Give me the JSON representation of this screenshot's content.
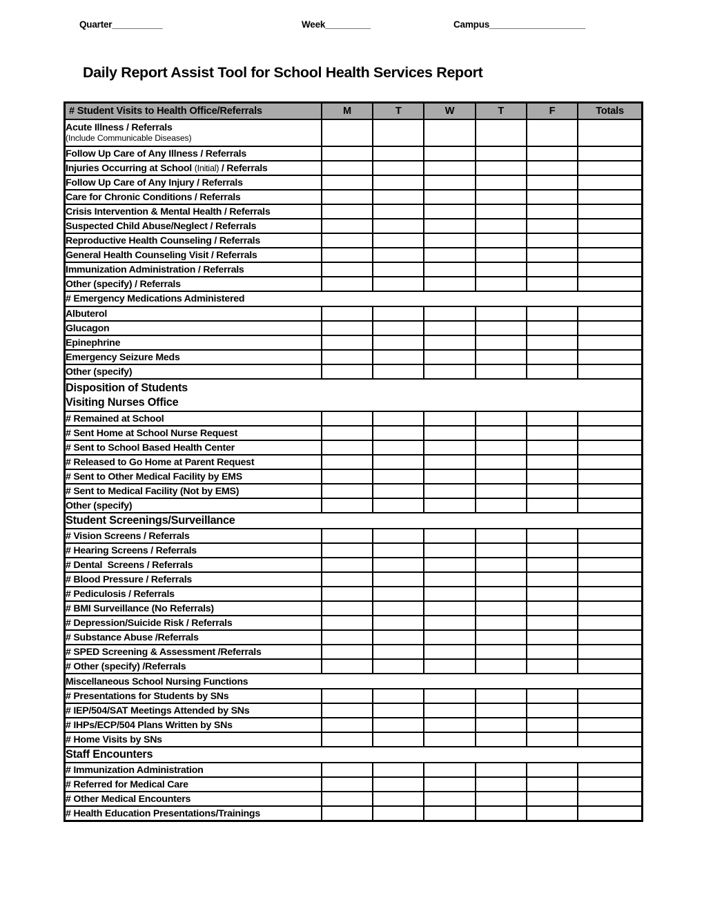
{
  "header": {
    "quarter": "Quarter__________",
    "week": "Week_________",
    "campus": "Campus___________________"
  },
  "title": "Daily Report Assist Tool for School Health Services Report",
  "table": {
    "columns": {
      "label": "# Student Visits to Health Office/Referrals",
      "days": [
        "M",
        "T",
        "W",
        "T",
        "F"
      ],
      "totals": "Totals"
    },
    "sections": [
      {
        "id": "student-visits",
        "header_in_column_row": true,
        "rows": [
          {
            "label": "Acute Illness / Referrals",
            "sub": "(Include Communicable Diseases)",
            "tall": true
          },
          {
            "label": "Follow Up Care of Any Illness / Referrals"
          },
          {
            "label_pre": "Injuries Occurring at School ",
            "label_reg": "(Initial)",
            "label_post": " / Referrals"
          },
          {
            "label": "Follow Up Care of Any Injury / Referrals"
          },
          {
            "label": "Care for Chronic Conditions / Referrals"
          },
          {
            "label": "Crisis Intervention & Mental Health / Referrals"
          },
          {
            "label": "Suspected Child Abuse/Neglect / Referrals"
          },
          {
            "label": "Reproductive Health Counseling / Referrals"
          },
          {
            "label": "General Health Counseling Visit / Referrals"
          },
          {
            "label": "Immunization Administration / Referrals"
          },
          {
            "label": "Other (specify) / Referrals"
          }
        ]
      },
      {
        "id": "emergency-medications",
        "title": "# Emergency Medications Administered",
        "style": "s-norm",
        "rows": [
          {
            "label": "Albuterol"
          },
          {
            "label": "Glucagon"
          },
          {
            "label": "Epinephrine"
          },
          {
            "label": "Emergency Seizure Meds"
          },
          {
            "label": "Other (specify)"
          }
        ]
      },
      {
        "id": "disposition-of-students",
        "title": "Disposition of Students\nVisiting Nurses Office",
        "style": "s-two",
        "rows": [
          {
            "label": "# Remained at School"
          },
          {
            "label": "# Sent Home at School Nurse Request"
          },
          {
            "label": "# Sent to School Based Health Center"
          },
          {
            "label": "# Released to Go Home at Parent Request"
          },
          {
            "label": "# Sent to Other Medical Facility by EMS"
          },
          {
            "label": "# Sent to Medical Facility (Not by EMS)"
          },
          {
            "label": "Other (specify)"
          }
        ]
      },
      {
        "id": "student-screenings",
        "title": "Student Screenings/Surveillance",
        "style": "s-big",
        "rows": [
          {
            "label": "# Vision Screens / Referrals"
          },
          {
            "label": "# Hearing Screens / Referrals"
          },
          {
            "label": "# Dental  Screens / Referrals"
          },
          {
            "label": "# Blood Pressure / Referrals"
          },
          {
            "label": "# Pediculosis / Referrals"
          },
          {
            "label": "# BMI Surveillance (No Referrals)"
          },
          {
            "label": "# Depression/Suicide Risk / Referrals"
          },
          {
            "label": "# Substance Abuse /Referrals"
          },
          {
            "label": "# SPED Screening & Assessment /Referrals"
          },
          {
            "label": "# Other (specify) /Referrals"
          }
        ]
      },
      {
        "id": "miscellaneous-nursing",
        "title": "Miscellaneous School Nursing Functions",
        "style": "s-cond",
        "rows": [
          {
            "label": "# Presentations for Students by SNs"
          },
          {
            "label": "# IEP/504/SAT Meetings Attended by SNs"
          },
          {
            "label": "# IHPs/ECP/504 Plans Written by SNs"
          },
          {
            "label": "# Home Visits by SNs"
          }
        ]
      },
      {
        "id": "staff-encounters",
        "title": "Staff Encounters",
        "style": "s-big",
        "rows": [
          {
            "label": "# Immunization Administration"
          },
          {
            "label": "# Referred for Medical Care"
          },
          {
            "label": "# Other Medical Encounters"
          },
          {
            "label": "# Health Education Presentations/Trainings"
          }
        ]
      }
    ]
  },
  "colors": {
    "section_gray": "#aaaaaa",
    "border": "#000000",
    "text": "#000000",
    "background": "#ffffff"
  }
}
